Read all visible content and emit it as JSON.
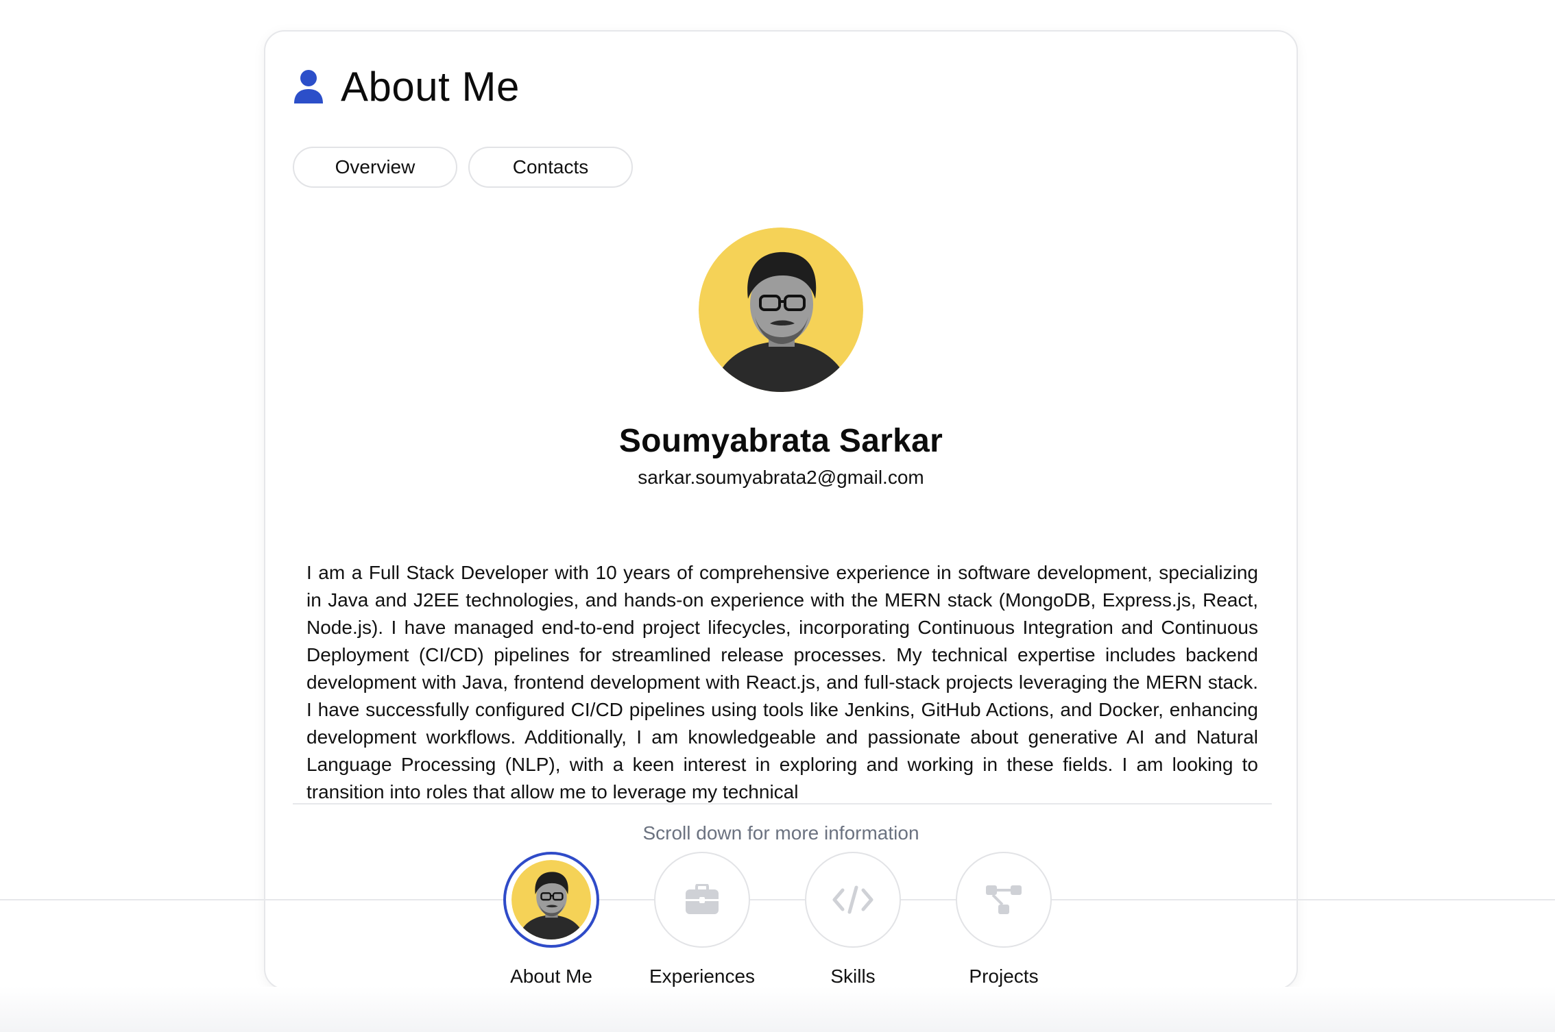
{
  "card": {
    "title": "About Me",
    "title_icon": "user-icon",
    "tabs": [
      {
        "label": "Overview"
      },
      {
        "label": "Contacts"
      }
    ]
  },
  "profile": {
    "name": "Soumyabrata Sarkar",
    "email": "sarkar.soumyabrata2@gmail.com",
    "avatar_bg_color": "#f5d257",
    "bio": "I am a Full Stack Developer with 10 years of comprehensive experience in software development, specializing in Java and J2EE technologies, and hands-on experience with the MERN stack (MongoDB, Express.js, React, Node.js). I have managed end-to-end project lifecycles, incorporating Continuous Integration and Continuous Deployment (CI/CD) pipelines for streamlined release processes. My technical expertise includes backend development with Java, frontend development with React.js, and full-stack projects leveraging the MERN stack. I have successfully configured CI/CD pipelines using tools like Jenkins, GitHub Actions, and Docker, enhancing development workflows. Additionally, I am knowledgeable and passionate about generative AI and Natural Language Processing (NLP), with a keen interest in exploring and working in these fields. I am looking to transition into roles that allow me to leverage my technical"
  },
  "scroll_hint": "Scroll down for more information",
  "dock": {
    "accent_color": "#2f4bc8",
    "items": [
      {
        "label": "About Me",
        "icon": "avatar",
        "active": true
      },
      {
        "label": "Experiences",
        "icon": "briefcase-icon",
        "active": false
      },
      {
        "label": "Skills",
        "icon": "code-icon",
        "active": false
      },
      {
        "label": "Projects",
        "icon": "project-tree-icon",
        "active": false
      }
    ]
  }
}
